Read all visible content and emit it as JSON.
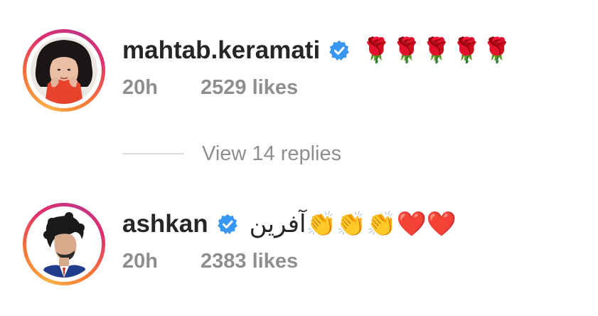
{
  "comments": [
    {
      "username": "mahtab.keramati",
      "verified": true,
      "text": "🌹🌹🌹🌹🌹",
      "time": "20h",
      "likes": "2529 likes"
    },
    {
      "username": "ashkan",
      "verified": true,
      "text": "آفرین👏👏👏❤️❤️",
      "time": "20h",
      "likes": "2383 likes"
    }
  ],
  "replies": {
    "label": "View 14 replies"
  },
  "colors": {
    "username": "#262626",
    "meta": "#8e8e8e",
    "verified": "#3897f0",
    "divider": "#dbdbdb"
  },
  "icons": {
    "verified": "verified-badge-icon"
  }
}
